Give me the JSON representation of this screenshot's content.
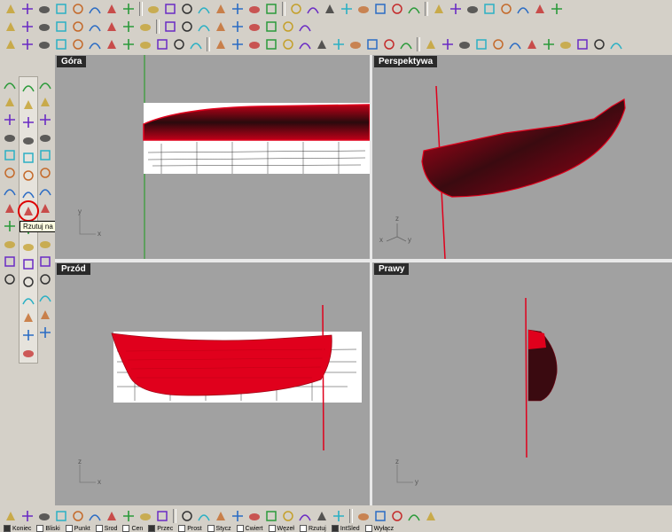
{
  "toolbar_top1": [
    "new-file-icon",
    "open-folder-icon",
    "save-icon",
    "print-icon",
    "copy-icon",
    "cut-icon",
    "paste-icon",
    "clipboard-icon",
    "undo-icon",
    "redo-icon",
    "pan-icon",
    "zoom-icon",
    "zoom-window-icon",
    "zoom-extents-icon",
    "zoom-selected-icon",
    "rotate-view-icon",
    "grid-icon",
    "car-icon",
    "render-icon",
    "layer-icon",
    "light-icon",
    "lock-icon",
    "material-icon",
    "color-wheel-icon",
    "sphere-icon",
    "globe-icon",
    "options-icon",
    "help-icon",
    "help2-icon",
    "plugin-icon",
    "properties-icon",
    "settings-icon"
  ],
  "toolbar_top2": [
    "curve-tool-icon",
    "dimension-icon",
    "arrow-icon",
    "move-icon",
    "rotate-icon",
    "scale-icon",
    "mirror-icon",
    "array-icon",
    "trim-icon",
    "split-icon",
    "join-icon",
    "explode-icon",
    "group-icon",
    "ungroup-icon",
    "block-icon",
    "analyze-icon",
    "mesh-icon",
    "box-icon"
  ],
  "toolbar_top3": [
    "edit-points-icon",
    "knot-icon",
    "rebuild-icon",
    "fair-icon",
    "match-icon",
    "blend-icon",
    "offset-icon",
    "loft-icon",
    "sweep-icon",
    "revolve-icon",
    "network-icon",
    "fit-label-icon",
    "deg-label-icon",
    "patch-icon",
    "extrude-icon",
    "cap-icon",
    "shell-icon",
    "boolean-icon",
    "fillet-icon",
    "chamfer-icon",
    "draft-icon",
    "project-icon",
    "pull-icon",
    "flow-icon",
    "splop-icon",
    "twist-icon",
    "bend-icon",
    "taper-icon",
    "smooth-icon",
    "cage-icon",
    "unroll-icon",
    "squish-icon",
    "contour-icon",
    "section-icon",
    "silhouette-icon",
    "material2-icon"
  ],
  "left_col_a": [
    "arc-icon",
    "arc2-icon",
    "arc3-icon",
    "box-solid-icon",
    "loft-surface-icon",
    "network-surface-icon",
    "patch-surface-icon",
    "line-icon",
    "polyline-icon",
    "freeform-icon",
    "point-curve-icon",
    "circle-curve-icon"
  ],
  "left_col_b": [
    "select-arrow-icon",
    "polyline-tool-icon",
    "circle-tool-icon",
    "triangle-icon",
    "point-tool-icon",
    "surface-tool-icon",
    "solid-box-icon",
    "project-to-surface-icon",
    "mesh-tool-icon",
    "curve-edit-icon",
    "extrude-curve-icon",
    "solid-boolean-icon",
    "curve-dir-icon",
    "text-icon",
    "array-icon2",
    "mesh-box-icon"
  ],
  "left_col_c": [
    "point-icon",
    "polygon-icon",
    "ellipse-icon",
    "rectangle-icon",
    "freeform-curve-icon",
    "fillet-curve-icon",
    "transform-icon",
    "plane-icon",
    "rotate3d-icon",
    "extrude-face-icon",
    "cap-holes-icon",
    "blend-surface-icon",
    "offset-curve-icon",
    "mirror2-icon",
    "diamond-icon"
  ],
  "tooltip": "Rzutuj na Powierzchnię",
  "viewports": {
    "top": {
      "title": "Góra"
    },
    "perspective": {
      "title": "Perspektywa"
    },
    "front": {
      "title": "Przód"
    },
    "right": {
      "title": "Prawy"
    }
  },
  "axes": {
    "top": {
      "a": "y",
      "b": "x"
    },
    "perspective": {
      "a": "z",
      "b": "x",
      "c": "y"
    },
    "front": {
      "a": "z",
      "b": "x"
    },
    "right": {
      "a": "z",
      "b": "y"
    }
  },
  "toolbar_bottom": [
    "line-tool-icon",
    "arc-tool-icon",
    "curve-tool2-icon",
    "spline-icon",
    "offset-tool-icon",
    "fillet-tool-icon",
    "blend-tool-icon",
    "fit-tool-icon",
    "deg-tool-icon",
    "fair-tool-icon",
    "match-tool-icon",
    "extend-icon",
    "split-tool-icon",
    "join-tool-icon",
    "trim-tool-icon",
    "explode-tool-icon",
    "rebuild-tool-icon",
    "project-tool-icon",
    "point-tool2-icon",
    "flip-icon",
    "close-curve-icon",
    "open-curve-icon",
    "snap-tool-icon",
    "gear-tool-icon",
    "camera-icon"
  ],
  "status": {
    "items": [
      {
        "label": "Koniec",
        "checked": true
      },
      {
        "label": "Bliski",
        "checked": false
      },
      {
        "label": "Punkt",
        "checked": false
      },
      {
        "label": "Środ",
        "checked": false
      },
      {
        "label": "Cen",
        "checked": false
      },
      {
        "label": "Przec",
        "checked": true
      },
      {
        "label": "Prost",
        "checked": false
      },
      {
        "label": "Stycz",
        "checked": false
      },
      {
        "label": "Ćwiert",
        "checked": false
      },
      {
        "label": "Węzeł",
        "checked": false
      },
      {
        "label": "Rzutuj",
        "checked": false
      },
      {
        "label": "IntŚled",
        "checked": true
      },
      {
        "label": "Wyłącz",
        "checked": false
      }
    ]
  },
  "colors": {
    "hull_red": "#e0001c",
    "hull_dark": "#2a0a0d",
    "viewport_bg": "#a1a1a1"
  }
}
